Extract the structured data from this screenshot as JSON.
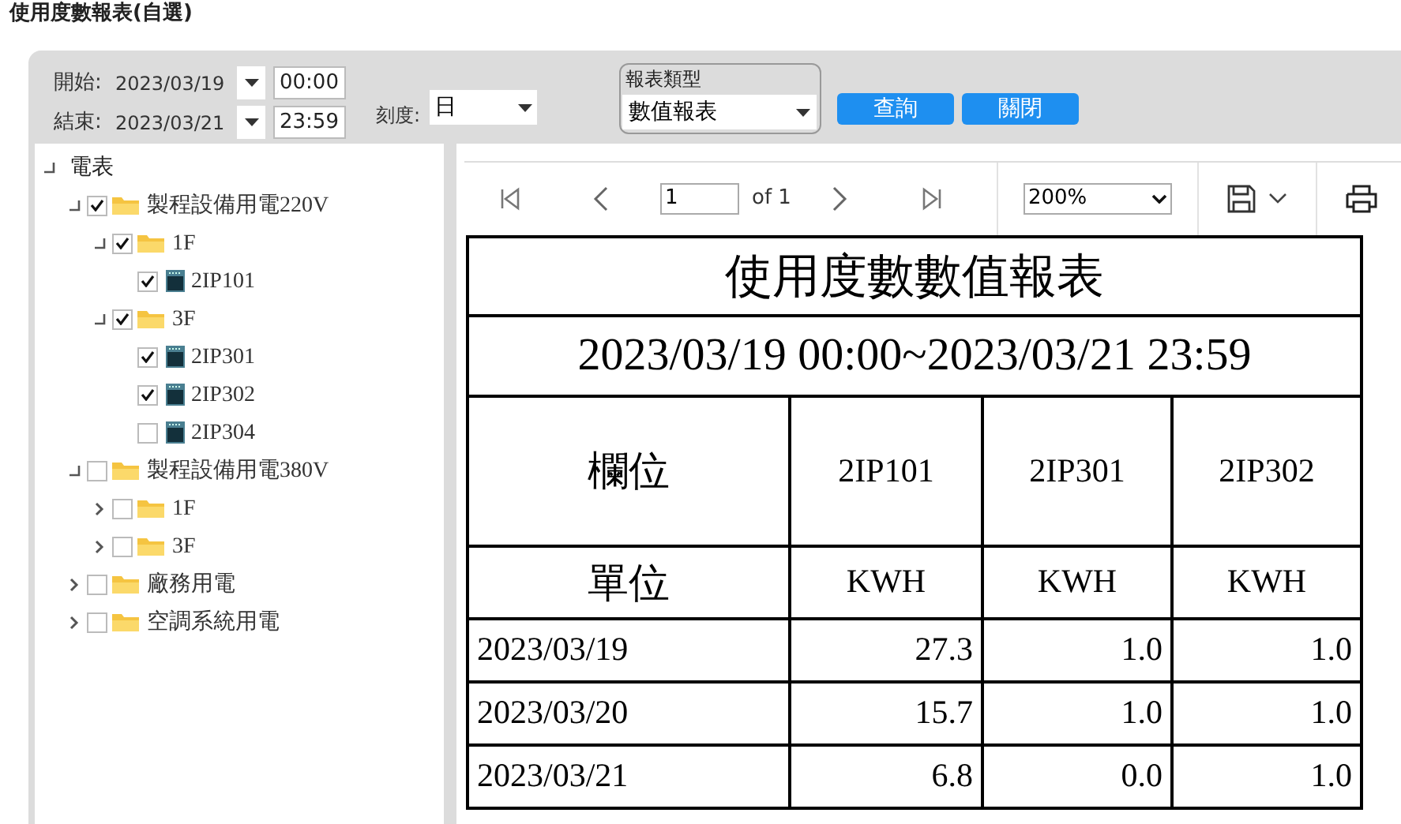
{
  "page_title": "使用度數報表(自選)",
  "filters": {
    "start": {
      "label": "開始:",
      "date": "2023/03/19",
      "time": "00:00"
    },
    "end": {
      "label": "結束:",
      "date": "2023/03/21",
      "time": "23:59"
    },
    "scale": {
      "label": "刻度:",
      "value": "日"
    },
    "report_type": {
      "legend": "報表類型",
      "value": "數值報表"
    },
    "buttons": [
      "查詢",
      "關閉"
    ]
  },
  "tree": {
    "label": "電表",
    "expanded": true,
    "children": [
      {
        "kind": "folder",
        "label": "製程設備用電220V",
        "checked": true,
        "expanded": true,
        "children": [
          {
            "kind": "folder",
            "label": "1F",
            "checked": true,
            "expanded": true,
            "children": [
              {
                "kind": "meter",
                "label": "2IP101",
                "checked": true
              }
            ]
          },
          {
            "kind": "folder",
            "label": "3F",
            "checked": true,
            "expanded": true,
            "children": [
              {
                "kind": "meter",
                "label": "2IP301",
                "checked": true
              },
              {
                "kind": "meter",
                "label": "2IP302",
                "checked": true
              },
              {
                "kind": "meter",
                "label": "2IP304",
                "checked": false
              }
            ]
          }
        ]
      },
      {
        "kind": "folder",
        "label": "製程設備用電380V",
        "checked": false,
        "expanded": true,
        "children": [
          {
            "kind": "folder",
            "label": "1F",
            "checked": false,
            "expanded": false
          },
          {
            "kind": "folder",
            "label": "3F",
            "checked": false,
            "expanded": false
          }
        ]
      },
      {
        "kind": "folder",
        "label": "廠務用電",
        "checked": false,
        "expanded": false
      },
      {
        "kind": "folder",
        "label": "空調系統用電",
        "checked": false,
        "expanded": false
      }
    ]
  },
  "viewer": {
    "page": "1",
    "page_count": "of 1",
    "zoom": "200%"
  },
  "report": {
    "title": "使用度數數值報表",
    "range": "2023/03/19 00:00~2023/03/21 23:59",
    "field_label": "欄位",
    "columns": [
      "2IP101",
      "2IP301",
      "2IP302"
    ],
    "unit_label": "單位",
    "units": [
      "KWH",
      "KWH",
      "KWH"
    ],
    "rows": [
      {
        "date": "2023/03/19",
        "values": [
          "27.3",
          "1.0",
          "1.0"
        ]
      },
      {
        "date": "2023/03/20",
        "values": [
          "15.7",
          "1.0",
          "1.0"
        ]
      },
      {
        "date": "2023/03/21",
        "values": [
          "6.8",
          "0.0",
          "1.0"
        ]
      }
    ]
  }
}
